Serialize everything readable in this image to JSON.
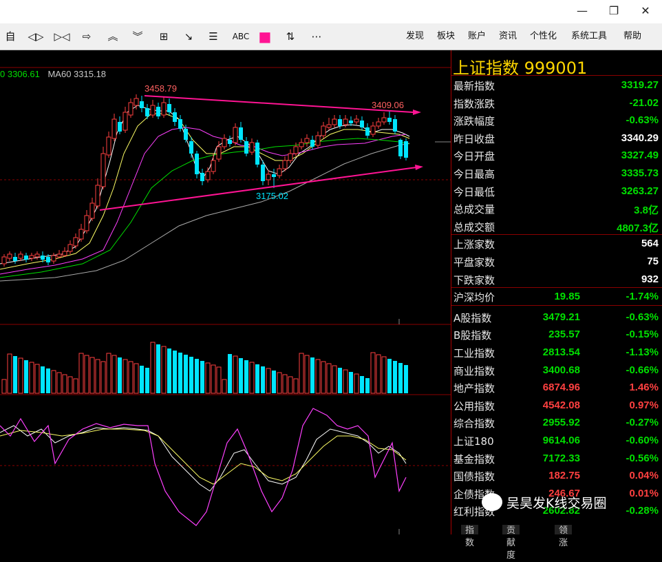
{
  "window": {
    "minimize": "—",
    "restore": "❐",
    "close": "✕"
  },
  "toolbar": {
    "tools": [
      "自",
      "◁▷",
      "▷◁",
      "⇨",
      "︽",
      "︾",
      "⊞",
      "↘",
      "☰",
      "ABC",
      "■",
      "⇅",
      "⋯"
    ],
    "menus": [
      "发现",
      "板块",
      "账户",
      "资讯",
      "个性化",
      "系统工具",
      "帮助"
    ]
  },
  "legend": {
    "ma30": "0 3306.61",
    "ma60": "MA60 3315.18"
  },
  "annotations": {
    "high1": "3458.79",
    "high2": "3409.06",
    "low": "3175.02"
  },
  "panel": {
    "title": "上证指数  999001",
    "quote": [
      {
        "label": "最新指数",
        "value": "3319.27",
        "color": "green"
      },
      {
        "label": "指数涨跌",
        "value": "-21.02",
        "color": "green"
      },
      {
        "label": "涨跌幅度",
        "value": "-0.63%",
        "color": "green"
      },
      {
        "label": "昨日收盘",
        "value": "3340.29",
        "color": "white"
      },
      {
        "label": "今日开盘",
        "value": "3327.49",
        "color": "green"
      },
      {
        "label": "今日最高",
        "value": "3335.73",
        "color": "green"
      },
      {
        "label": "今日最低",
        "value": "3263.27",
        "color": "green"
      },
      {
        "label": "总成交量",
        "value": "3.8亿",
        "color": "green"
      },
      {
        "label": "总成交额",
        "value": "4807.3亿",
        "color": "green"
      }
    ],
    "breadth": [
      {
        "label": "上涨家数",
        "value": "564"
      },
      {
        "label": "平盘家数",
        "value": "75"
      },
      {
        "label": "下跌家数",
        "value": "932"
      }
    ],
    "hs": {
      "label": "沪深均价",
      "price": "19.85",
      "pct": "-1.74%"
    },
    "indices": [
      {
        "label": "A股指数",
        "price": "3479.21",
        "pct": "-0.63%",
        "color": "green"
      },
      {
        "label": "B股指数",
        "price": "235.57",
        "pct": "-0.15%",
        "color": "green"
      },
      {
        "label": "工业指数",
        "price": "2813.54",
        "pct": "-1.13%",
        "color": "green"
      },
      {
        "label": "商业指数",
        "price": "3400.68",
        "pct": "-0.66%",
        "color": "green"
      },
      {
        "label": "地产指数",
        "price": "6874.96",
        "pct": "1.46%",
        "color": "red"
      },
      {
        "label": "公用指数",
        "price": "4542.08",
        "pct": "0.97%",
        "color": "red"
      },
      {
        "label": "综合指数",
        "price": "2955.92",
        "pct": "-0.27%",
        "color": "green"
      },
      {
        "label": "上证180",
        "price": "9614.06",
        "pct": "-0.60%",
        "color": "green"
      },
      {
        "label": "基金指数",
        "price": "7172.33",
        "pct": "-0.56%",
        "color": "green"
      },
      {
        "label": "国债指数",
        "price": "182.75",
        "pct": "0.04%",
        "color": "red"
      },
      {
        "label": "企债指数",
        "price": "246.67",
        "pct": "0.01%",
        "color": "red"
      },
      {
        "label": "红利指数",
        "price": "2602.82",
        "pct": "-0.28%",
        "color": "green"
      }
    ]
  },
  "watermark": "吴昊发K线交易圈",
  "bottom_tabs": [
    "指数",
    "贡献度",
    "领涨"
  ],
  "colors": {
    "up": "#ff4040",
    "down": "#00e5ff",
    "accent": "#ff1493",
    "gold": "#ffd700"
  }
}
